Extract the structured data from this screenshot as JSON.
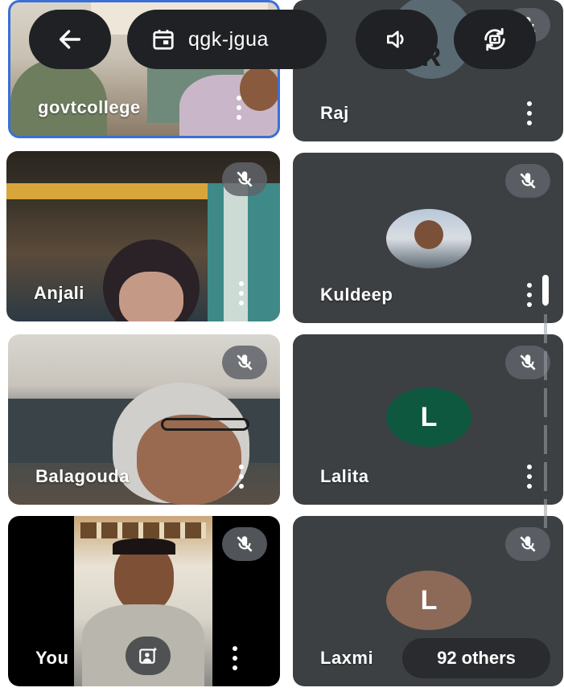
{
  "meeting": {
    "code": "qgk-jgua"
  },
  "participants": [
    {
      "name": "govtcollege"
    },
    {
      "name": "Raj",
      "avatar_letter": "R"
    },
    {
      "name": "Anjali"
    },
    {
      "name": "Kuldeep"
    },
    {
      "name": "Balagouda"
    },
    {
      "name": "Lalita",
      "avatar_letter": "L"
    },
    {
      "name": "You"
    },
    {
      "name": "Laxmi",
      "avatar_letter": "L"
    }
  ],
  "others_label": "92 others",
  "colors": {
    "tile_bg": "#3c4043",
    "lalita_avatar": "#0e5840",
    "laxmi_avatar": "#8d6a58",
    "raj_avatar": "#5a6a73",
    "active_border": "#3a6fd8"
  },
  "icons": {
    "back": "arrow-left-icon",
    "calendar": "calendar-icon",
    "speaker": "speaker-icon",
    "camera_flip": "camera-flip-icon",
    "mic_off": "mic-off-icon",
    "more": "more-vert-icon",
    "effects": "effects-icon"
  }
}
